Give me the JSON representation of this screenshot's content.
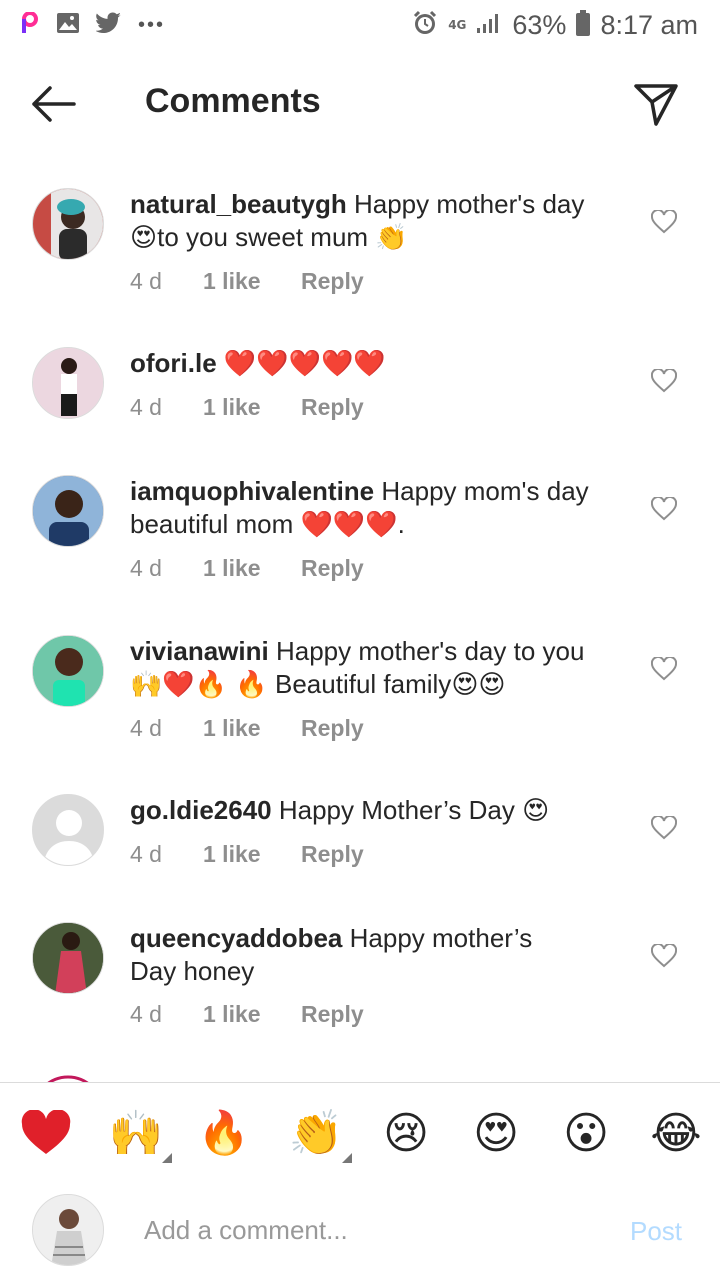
{
  "status_bar": {
    "network": "4G",
    "battery": "63%",
    "time": "8:17 am",
    "left_icons": [
      "picsart-icon",
      "gallery-icon",
      "twitter-icon",
      "more-dots-icon"
    ],
    "right_icons": [
      "alarm-icon",
      "signal-icon",
      "battery-icon"
    ]
  },
  "header": {
    "title": "Comments",
    "back_icon": "arrow-left-icon",
    "share_icon": "paper-plane-icon"
  },
  "comments": [
    {
      "username": "natural_beautygh",
      "text_1": "Happy mother's day",
      "emoji_1": "😍",
      "text_2": "to you sweet mum",
      "emoji_2": "👏",
      "time": "4 d",
      "likes": "1 like",
      "reply": "Reply"
    },
    {
      "username": "ofori.le",
      "emoji": "❤️❤️❤️❤️❤️",
      "time": "4 d",
      "likes": "1 like",
      "reply": "Reply"
    },
    {
      "username": "iamquophivalentine",
      "text_1": "Happy mom's day",
      "text_2": "beautiful mom",
      "emoji": "❤️❤️❤️",
      "suffix": ".",
      "time": "4 d",
      "likes": "1 like",
      "reply": "Reply"
    },
    {
      "username": "vivianawini",
      "text_1": "Happy mother's day to you",
      "emoji_1": "🙌❤️🔥 🔥",
      "text_2": "Beautiful family",
      "emoji_2": "😍😍",
      "time": "4 d",
      "likes": "1 like",
      "reply": "Reply"
    },
    {
      "username": "go.ldie2640",
      "text_1": "Happy Mother’s Day",
      "emoji": "😍",
      "time": "4 d",
      "likes": "1 like",
      "reply": "Reply"
    },
    {
      "username": "queencyaddobea",
      "text_1": "Happy mother’s",
      "text_2": "Day honey",
      "time": "4 d",
      "likes": "1 like",
      "reply": "Reply"
    }
  ],
  "emoji_bar": [
    "❤️",
    "🙌",
    "🔥",
    "👏",
    "😢",
    "😍",
    "😮",
    "😂"
  ],
  "input": {
    "placeholder": "Add a comment...",
    "value": "",
    "post_label": "Post"
  },
  "colors": {
    "text": "#262626",
    "meta": "#8e8e8e",
    "post_disabled": "#b3dbff",
    "divider": "#dbdbdb"
  }
}
